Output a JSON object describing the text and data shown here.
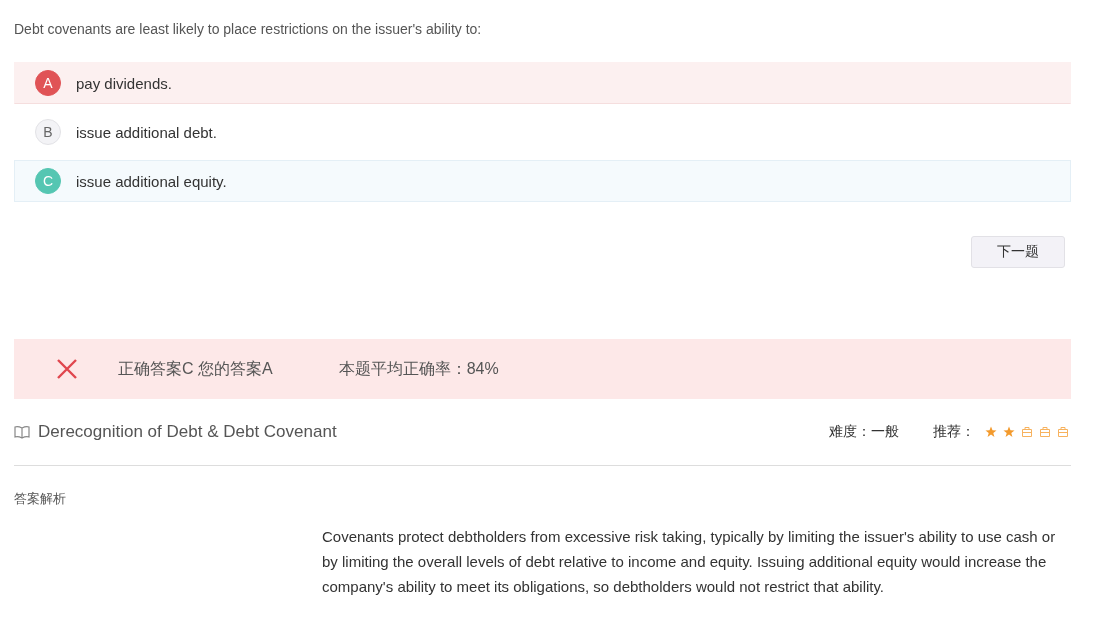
{
  "question": "Debt covenants are least likely to place restrictions on the issuer's ability to:",
  "options": [
    {
      "letter": "A",
      "text": "pay dividends.",
      "kind": "wrong"
    },
    {
      "letter": "B",
      "text": "issue additional debt.",
      "kind": "plain"
    },
    {
      "letter": "C",
      "text": "issue additional equity.",
      "kind": "correct"
    }
  ],
  "next_button": "下一题",
  "result": {
    "correct": false,
    "answers": "正确答案C 您的答案A",
    "average": "本题平均正确率：84%"
  },
  "topic": "Derecognition of Debt  & Debt Covenant",
  "difficulty": "难度：一般",
  "recommend": {
    "label": "推荐：",
    "stars": 2
  },
  "analysis_title": "答案解析",
  "analysis": "Covenants protect debtholders from excessive risk taking, typically by limiting the issuer's ability to use cash or by limiting the overall levels of debt relative to income and equity. Issuing additional equity would increase the company's ability to meet its obligations, so debtholders would not restrict that ability."
}
